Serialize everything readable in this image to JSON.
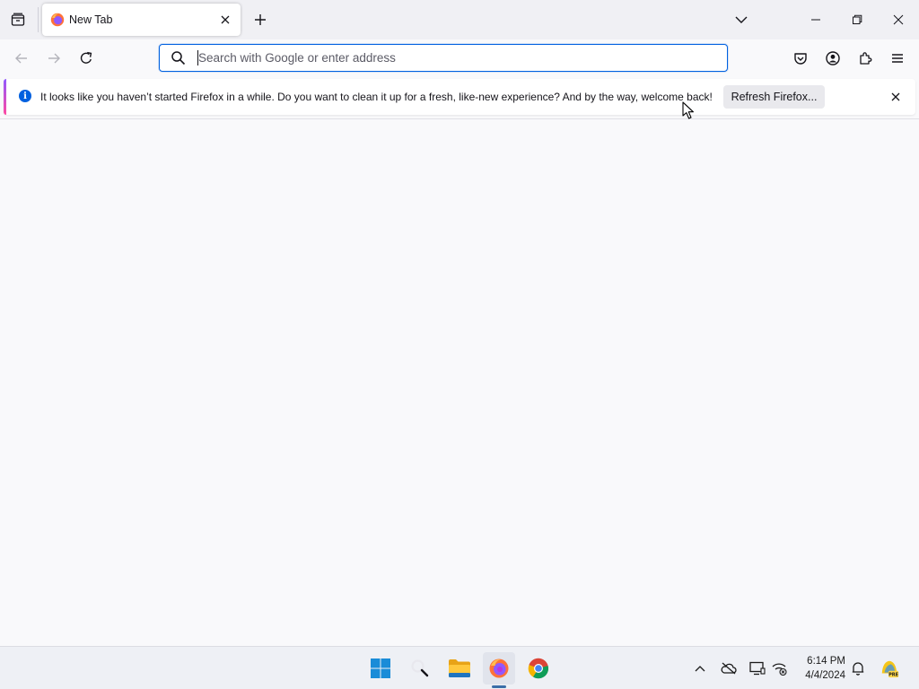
{
  "browser": {
    "tab": {
      "title": "New Tab"
    },
    "urlbar": {
      "placeholder": "Search with Google or enter address",
      "value": ""
    }
  },
  "notification": {
    "message": "It looks like you haven’t started Firefox in a while. Do you want to clean it up for a fresh, like-new experience? And by the way, welcome back!",
    "button_label": "Refresh Firefox..."
  },
  "taskbar": {
    "time": "6:14 PM",
    "date": "4/4/2024",
    "pinned_apps": [
      "start-icon",
      "search-icon",
      "file-explorer-icon",
      "firefox-icon",
      "chrome-icon"
    ],
    "tray_icons": [
      "chevron-up-icon",
      "onedrive-icon",
      "display-icon",
      "network-icon",
      "bell-icon",
      "copilot-icon"
    ]
  },
  "colors": {
    "accent": "#0061e0",
    "tab_strip_bg": "#f0f0f4",
    "content_bg": "#f9f9fb",
    "notification_icon": "#0060df"
  }
}
